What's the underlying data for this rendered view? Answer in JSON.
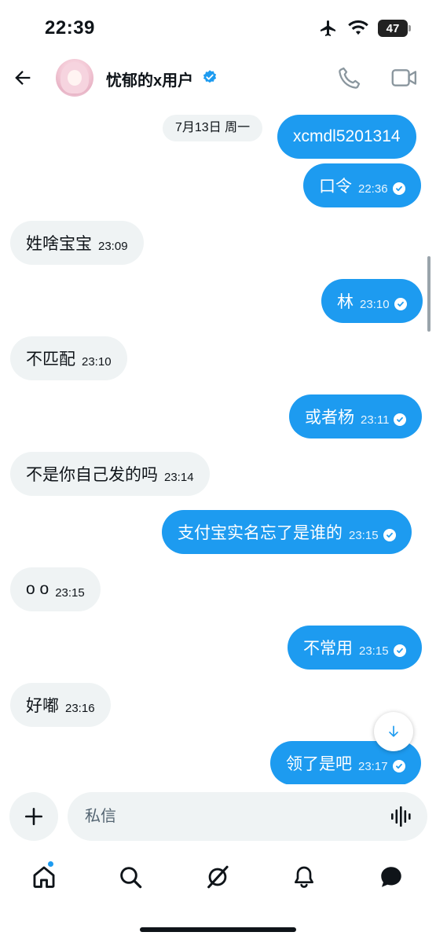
{
  "status_bar": {
    "time": "22:39",
    "battery": "47"
  },
  "header": {
    "contact_name": "忧郁的x用户"
  },
  "date_separator": "7月13日 周一",
  "messages": [
    {
      "text": "xcmdl5201314",
      "time": ""
    },
    {
      "text": "口令",
      "time": "22:36"
    },
    {
      "text": "姓啥宝宝",
      "time": "23:09"
    },
    {
      "text": "林",
      "time": "23:10"
    },
    {
      "text": "不匹配",
      "time": "23:10"
    },
    {
      "text": "或者杨",
      "time": "23:11"
    },
    {
      "text": "不是你自己发的吗",
      "time": "23:14"
    },
    {
      "text": "支付宝实名忘了是谁的",
      "time": "23:15"
    },
    {
      "text": "o o",
      "time": "23:15"
    },
    {
      "text": "不常用",
      "time": "23:15"
    },
    {
      "text": "好嘟",
      "time": "23:16"
    },
    {
      "text": "领了是吧",
      "time": "23:17"
    }
  ],
  "composer": {
    "placeholder": "私信"
  },
  "colors": {
    "accent": "#1d9bf0",
    "incoming_bubble": "#eff3f4",
    "text": "#0f1419"
  },
  "icons": [
    "airplane-icon",
    "wifi-icon",
    "battery-icon",
    "back-arrow-icon",
    "verified-badge-icon",
    "phone-icon",
    "video-icon",
    "read-check-icon",
    "arrow-down-icon",
    "plus-icon",
    "voice-wave-icon",
    "home-icon",
    "search-icon",
    "grok-icon",
    "bell-icon",
    "messages-icon"
  ]
}
